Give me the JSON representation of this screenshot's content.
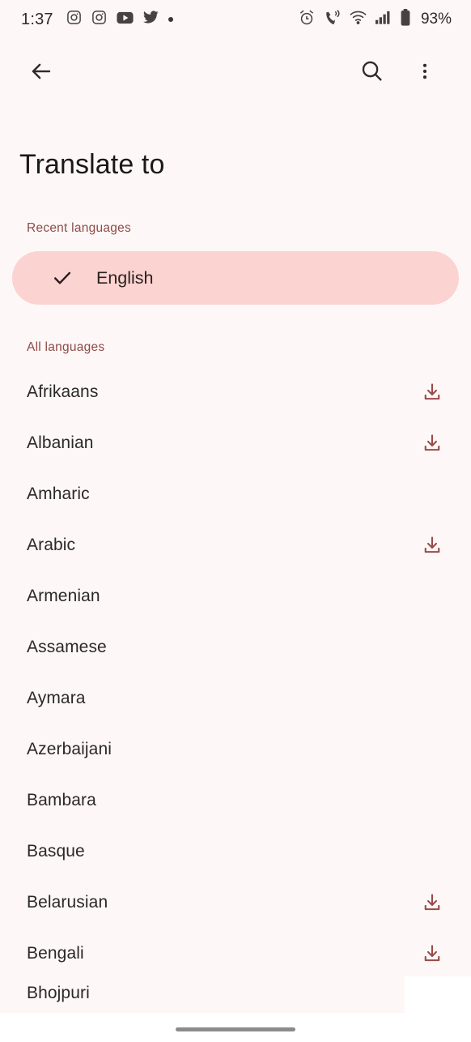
{
  "status_bar": {
    "time": "1:37",
    "battery_percent": "93%",
    "left_icons": [
      "instagram-icon",
      "instagram-icon",
      "youtube-icon",
      "twitter-icon",
      "more-notifications-dot"
    ],
    "right_icons": [
      "alarm-icon",
      "call-vibrate-icon",
      "wifi-icon",
      "cellular-signal-icon",
      "battery-icon"
    ]
  },
  "toolbar": {
    "back_label": "Back",
    "search_label": "Search",
    "overflow_label": "More options"
  },
  "header": {
    "title": "Translate to"
  },
  "sections": {
    "recent_label": "Recent languages",
    "all_label": "All languages"
  },
  "recent": [
    {
      "name": "English",
      "selected": true
    }
  ],
  "languages": [
    {
      "name": "Afrikaans",
      "downloadable": true
    },
    {
      "name": "Albanian",
      "downloadable": true
    },
    {
      "name": "Amharic",
      "downloadable": false
    },
    {
      "name": "Arabic",
      "downloadable": true
    },
    {
      "name": "Armenian",
      "downloadable": false
    },
    {
      "name": "Assamese",
      "downloadable": false
    },
    {
      "name": "Aymara",
      "downloadable": false
    },
    {
      "name": "Azerbaijani",
      "downloadable": false
    },
    {
      "name": "Bambara",
      "downloadable": false
    },
    {
      "name": "Basque",
      "downloadable": false
    },
    {
      "name": "Belarusian",
      "downloadable": true
    },
    {
      "name": "Bengali",
      "downloadable": true
    },
    {
      "name": "Bhojpuri",
      "downloadable": false
    }
  ],
  "colors": {
    "background": "#FDF8F7",
    "accent": "#8f4a49",
    "pill_background": "#FBD3D1",
    "text_primary": "#2b2827",
    "download_icon": "#9a4a48",
    "nav_pill": "#8b8b8b"
  }
}
